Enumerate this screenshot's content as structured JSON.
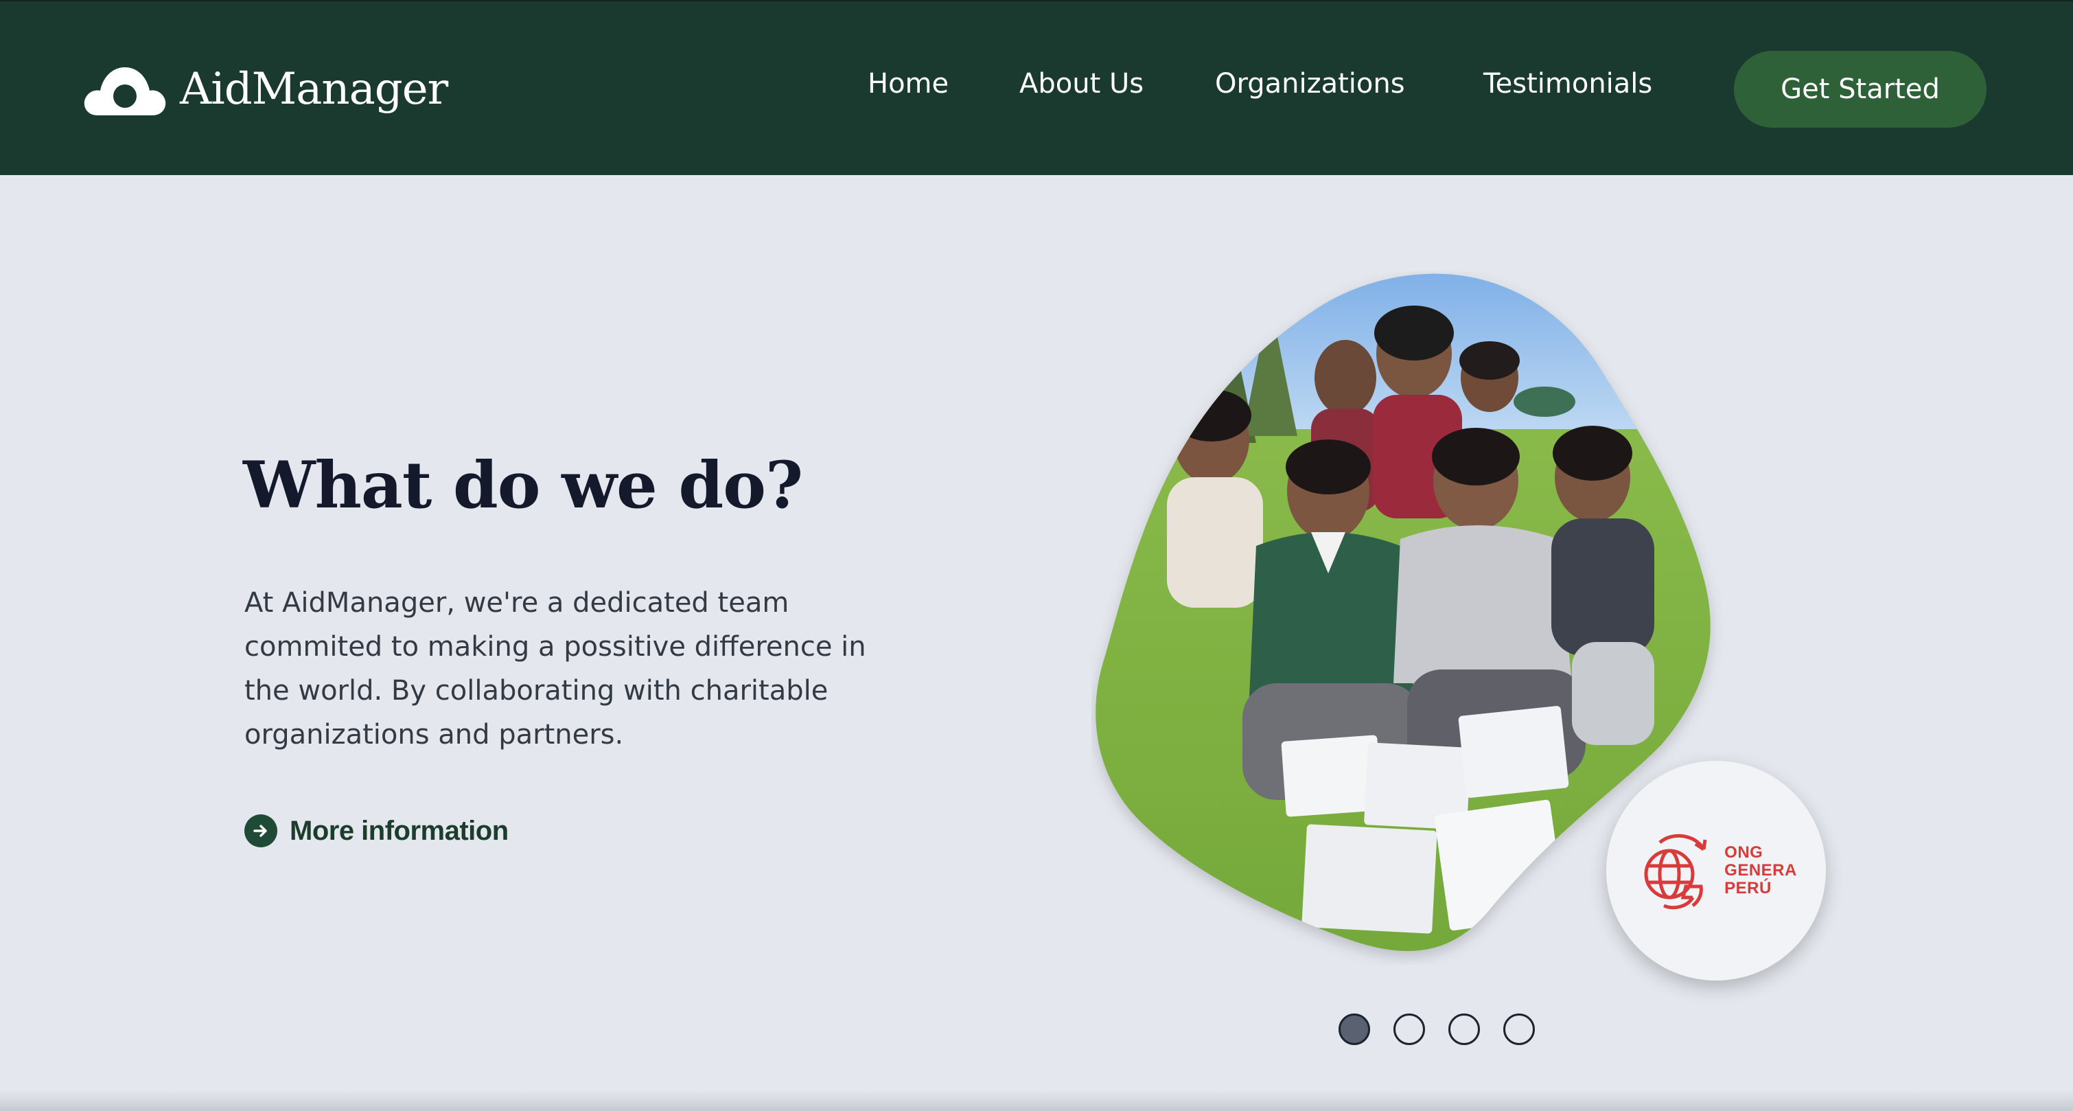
{
  "brand": {
    "name": "AidManager",
    "logo_icon": "cloud-logo-icon"
  },
  "nav": {
    "items": [
      {
        "label": "Home"
      },
      {
        "label": "About Us"
      },
      {
        "label": "Organizations"
      },
      {
        "label": "Testimonials"
      }
    ],
    "cta_label": "Get Started"
  },
  "hero": {
    "title": "What do we do?",
    "description": "At AidManager, we're a dedicated team commited to making a possitive difference in the world. By collaborating with charitable organizations and partners.",
    "more_label": "More information",
    "more_icon": "arrow-right-circle-icon"
  },
  "slide": {
    "image_icon": "group-of-children-photo",
    "partner": {
      "line1": "ONG",
      "line2": "GENERA",
      "line3": "PERÚ"
    }
  },
  "carousel": {
    "active_index": 0,
    "count": 4
  },
  "colors": {
    "header_bg": "#1a3a30",
    "page_bg": "#e4e8ee",
    "button_bg": "#2e6138",
    "title_text": "#141a2b",
    "link_text": "#1c3d2c",
    "partner_red": "#d93a3a"
  }
}
